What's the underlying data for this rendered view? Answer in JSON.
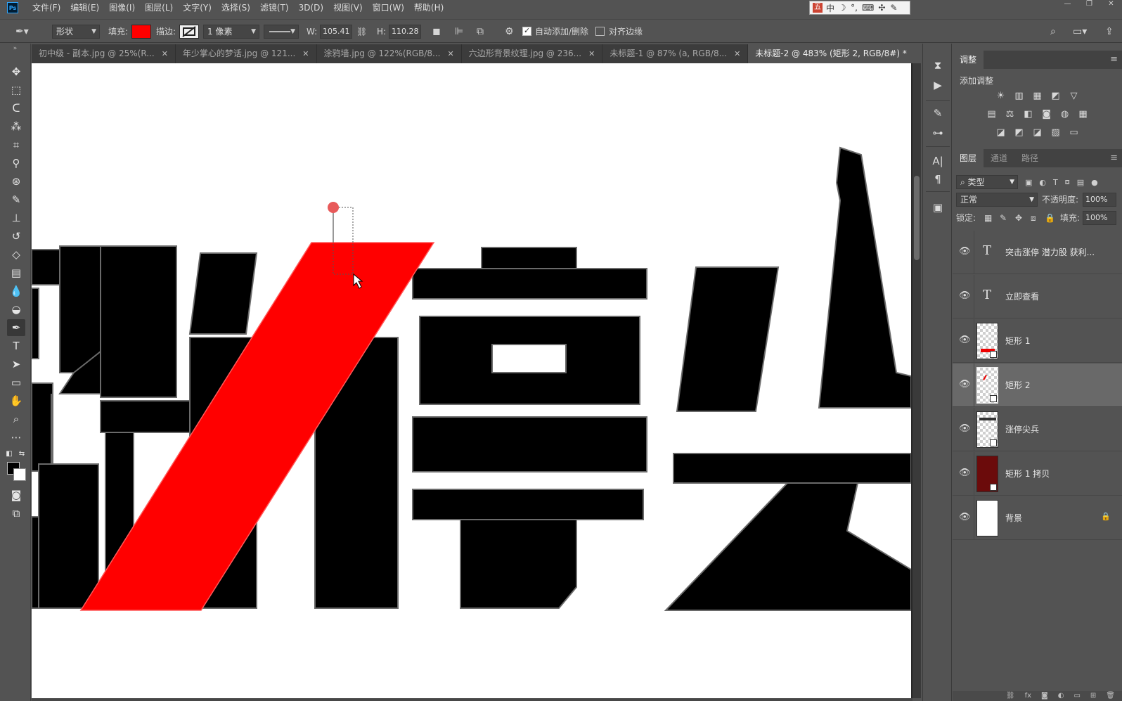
{
  "menu": {
    "app_icon_label": "Ps",
    "items": [
      "文件(F)",
      "编辑(E)",
      "图像(I)",
      "图层(L)",
      "文字(Y)",
      "选择(S)",
      "滤镜(T)",
      "3D(D)",
      "视图(V)",
      "窗口(W)",
      "帮助(H)"
    ]
  },
  "ime_bar": {
    "logo": "五",
    "items": [
      "中",
      "☽",
      "°,",
      "⌨",
      "✣",
      "✎"
    ]
  },
  "window_controls": {
    "minimize": "—",
    "restore": "❐",
    "close": "✕"
  },
  "options": {
    "tool_mode": "形状",
    "fill_label": "填充:",
    "fill_color": "#ff0000",
    "stroke_label": "描边:",
    "stroke_width": "1 像素",
    "w_label": "W:",
    "w_value": "105.41 |",
    "h_label": "H:",
    "h_value": "110.28 |",
    "auto_add_delete_label": "自动添加/删除",
    "auto_add_delete_checked": true,
    "align_edges_label": "对齐边缘",
    "align_edges_checked": false
  },
  "doc_tabs": [
    {
      "title": "初中级 - 副本.jpg @ 25%(R...",
      "active": false
    },
    {
      "title": "年少掌心的梦话.jpg @ 121...",
      "active": false
    },
    {
      "title": "涂鸦墙.jpg @ 122%(RGB/8...",
      "active": false
    },
    {
      "title": "六边形背景纹理.jpg @ 236...",
      "active": false
    },
    {
      "title": "未标题-1 @ 87% (a, RGB/8...",
      "active": false
    },
    {
      "title": "未标题-2 @ 483% (矩形 2, RGB/8#) *",
      "active": true
    }
  ],
  "doc_tab_close": "✕",
  "canvas": {
    "background": "#ffffff",
    "ink_color": "#000000",
    "shape_color": "#ff0000",
    "anchor_color": "#e85a5a"
  },
  "panels": {
    "adjustments": {
      "tab": "调整",
      "title": "添加调整",
      "row1": [
        "☀",
        "▥",
        "▦",
        "◩",
        "▽"
      ],
      "row2": [
        "▤",
        "⚖",
        "◧",
        "◙",
        "◍",
        "▦"
      ],
      "row3": [
        "◪",
        "◩",
        "◪",
        "▨",
        "▭"
      ]
    },
    "layers": {
      "tabs": [
        "图层",
        "通道",
        "路径"
      ],
      "filter_label": "类型",
      "blend_mode": "正常",
      "opacity_label": "不透明度:",
      "opacity_value": "100%",
      "lock_label": "锁定:",
      "fill_label": "填充:",
      "fill_value": "100%",
      "items": [
        {
          "name": "突击涨停 潜力股 获利...",
          "kind": "text",
          "selected": false
        },
        {
          "name": "立即查看",
          "kind": "text",
          "selected": false
        },
        {
          "name": "矩形 1",
          "kind": "shape-red",
          "selected": false
        },
        {
          "name": "矩形 2",
          "kind": "shape-slash",
          "selected": true
        },
        {
          "name": "涨停尖兵",
          "kind": "shape-text",
          "selected": false
        },
        {
          "name": "矩形 1 拷贝",
          "kind": "shape-dark",
          "selected": false
        },
        {
          "name": "背景",
          "kind": "background",
          "selected": false,
          "locked": true
        }
      ]
    }
  }
}
